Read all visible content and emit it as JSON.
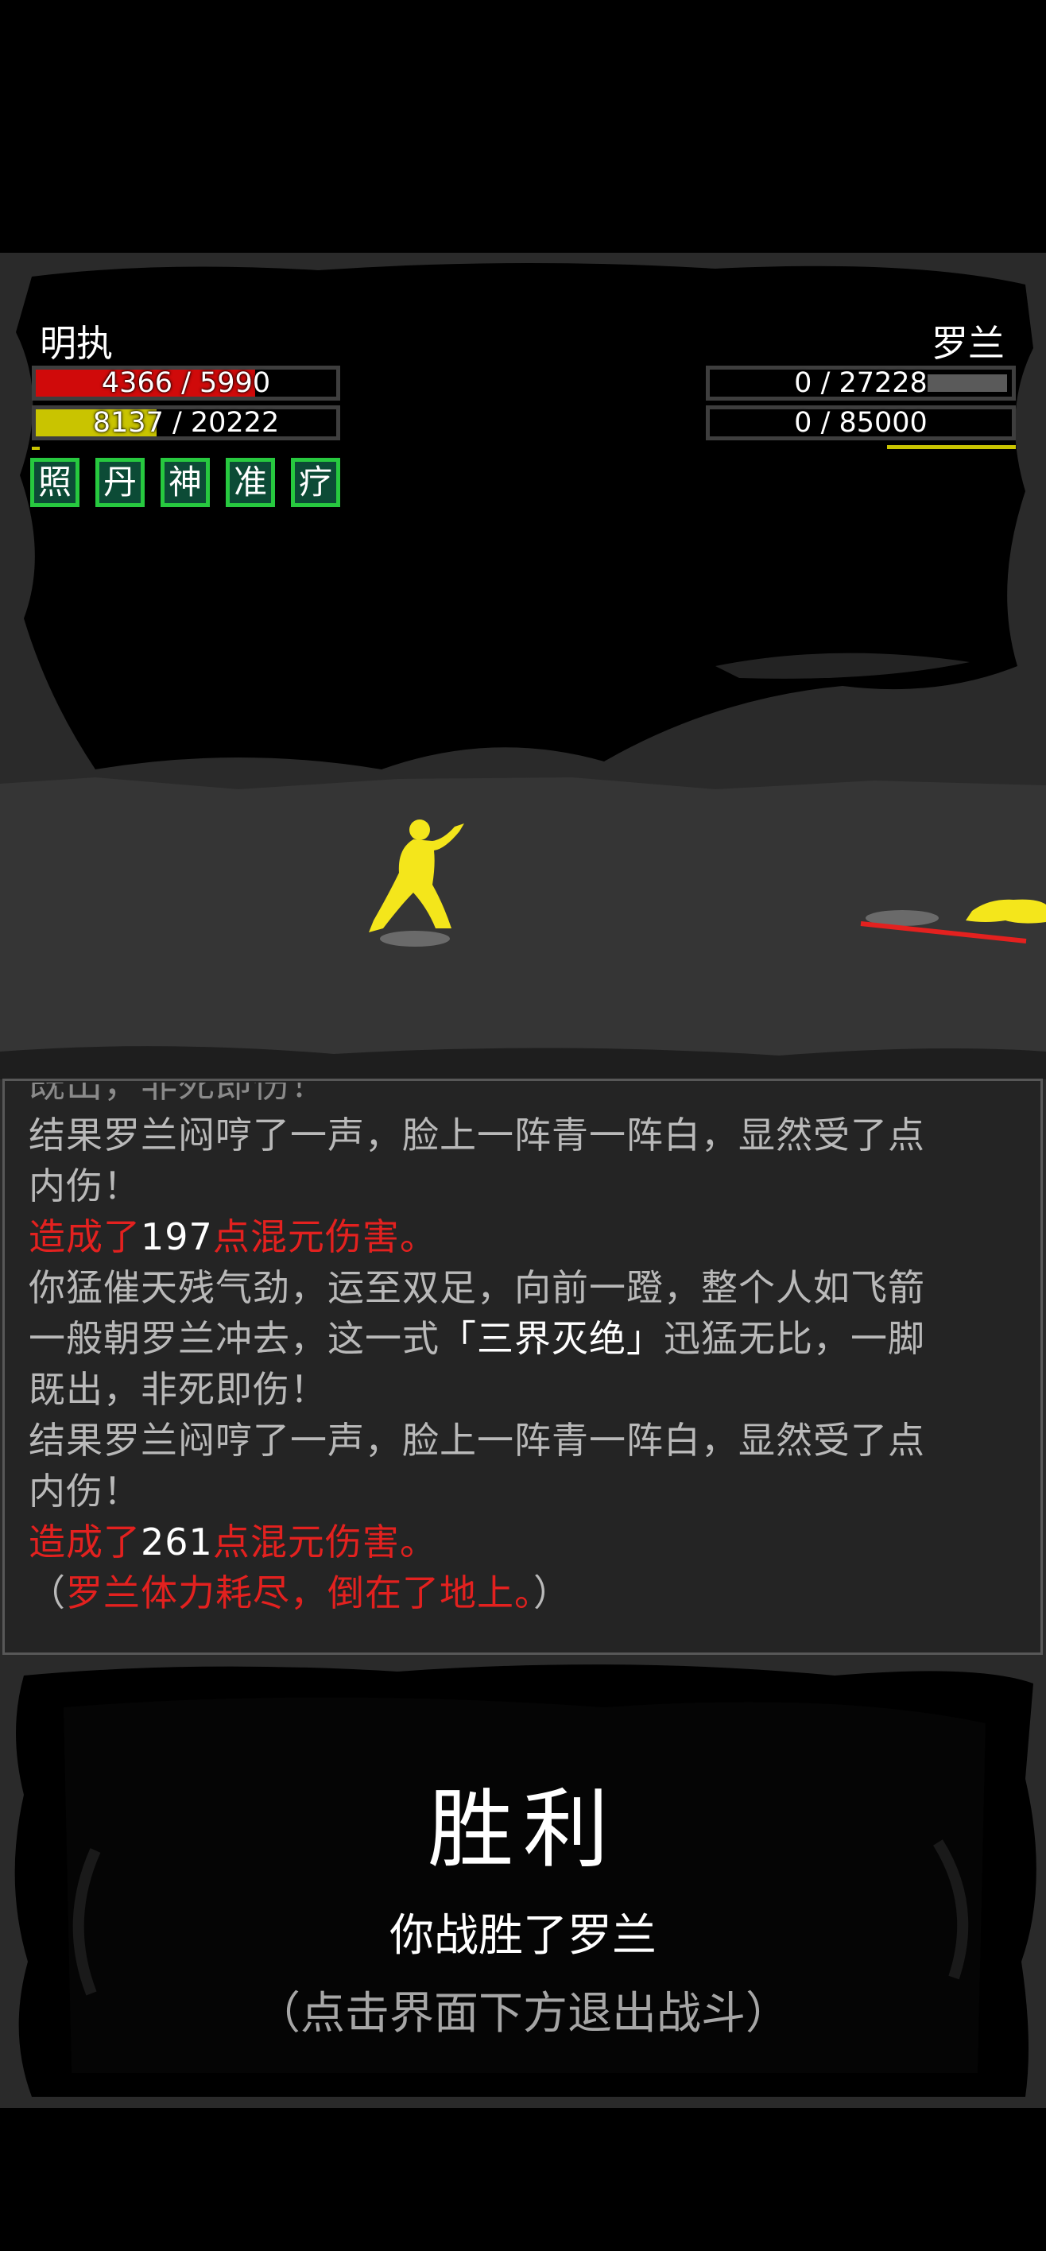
{
  "player": {
    "name": "明执",
    "hp_text": "4366 / 5990",
    "hp_current": 4366,
    "hp_max": 5990,
    "mp_text": "8137 / 20222",
    "mp_current": 8137,
    "mp_max": 20222,
    "hp_color": "#d00a0a",
    "mp_color": "#c9c400",
    "buffs": [
      "照",
      "丹",
      "神",
      "准",
      "疗"
    ]
  },
  "enemy": {
    "name": "罗兰",
    "hp_text": "0 / 27228",
    "hp_current": 0,
    "hp_max": 27228,
    "mp_text": "0 / 85000",
    "mp_current": 0,
    "mp_max": 85000,
    "status": "defeated"
  },
  "battle_log": {
    "lines": [
      "结果罗兰闷哼了一声，脸上一阵青一阵白，显然受了点",
      "内伤！",
      "damage_197",
      "你猛催天残气劲，运至双足，向前一蹬，整个人如飞箭",
      "skill_line",
      "既出，非死即伤！",
      "结果罗兰闷哼了一声，脸上一阵青一阵白，显然受了点",
      "内伤！",
      "damage_261",
      "defeat_note"
    ],
    "line1": "结果罗兰闷哼了一声，脸上一阵青一阵白，显然受了点",
    "line2": "内伤！",
    "dmg1_prefix": "造成了",
    "dmg1_value": "197",
    "dmg1_suffix": "点混元伤害。",
    "line4": "你猛催天残气劲，运至双足，向前一蹬，整个人如飞箭",
    "line5_prefix": "一般朝罗兰冲去，这一式",
    "line5_skill": "「三界灭绝」",
    "line5_suffix": "迅猛无比，一脚",
    "line6": "既出，非死即伤！",
    "line7": "结果罗兰闷哼了一声，脸上一阵青一阵白，显然受了点",
    "line8": "内伤！",
    "dmg2_prefix": "造成了",
    "dmg2_value": "261",
    "dmg2_suffix": "点混元伤害。",
    "note_open": "（",
    "note_text": "罗兰体力耗尽，倒在了地上。",
    "note_close": "）"
  },
  "result": {
    "title": "胜利",
    "subtitle": "你战胜了罗兰",
    "hint": "（点击界面下方退出战斗）"
  },
  "colors": {
    "damage_red": "#e3211f",
    "fighter_yellow": "#f4e61b",
    "log_text": "#b9b9b9"
  }
}
